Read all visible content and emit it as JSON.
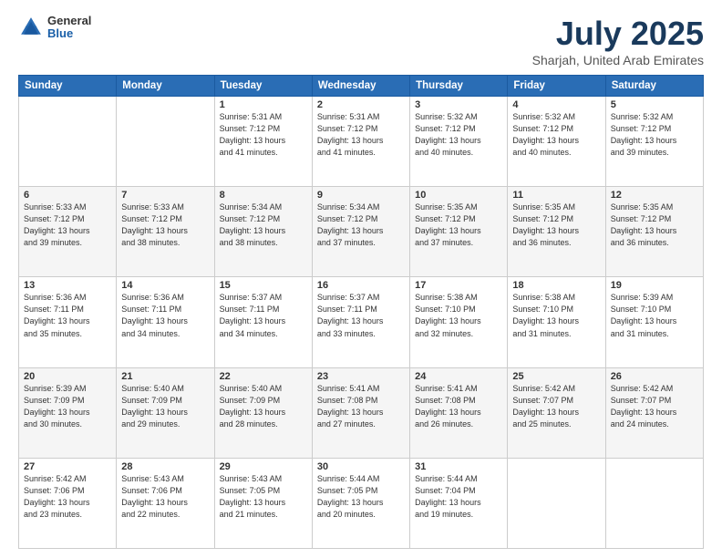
{
  "header": {
    "logo": {
      "general": "General",
      "blue": "Blue"
    },
    "month": "July 2025",
    "location": "Sharjah, United Arab Emirates"
  },
  "weekdays": [
    "Sunday",
    "Monday",
    "Tuesday",
    "Wednesday",
    "Thursday",
    "Friday",
    "Saturday"
  ],
  "weeks": [
    [
      {
        "day": "",
        "info": ""
      },
      {
        "day": "",
        "info": ""
      },
      {
        "day": "1",
        "info": "Sunrise: 5:31 AM\nSunset: 7:12 PM\nDaylight: 13 hours\nand 41 minutes."
      },
      {
        "day": "2",
        "info": "Sunrise: 5:31 AM\nSunset: 7:12 PM\nDaylight: 13 hours\nand 41 minutes."
      },
      {
        "day": "3",
        "info": "Sunrise: 5:32 AM\nSunset: 7:12 PM\nDaylight: 13 hours\nand 40 minutes."
      },
      {
        "day": "4",
        "info": "Sunrise: 5:32 AM\nSunset: 7:12 PM\nDaylight: 13 hours\nand 40 minutes."
      },
      {
        "day": "5",
        "info": "Sunrise: 5:32 AM\nSunset: 7:12 PM\nDaylight: 13 hours\nand 39 minutes."
      }
    ],
    [
      {
        "day": "6",
        "info": "Sunrise: 5:33 AM\nSunset: 7:12 PM\nDaylight: 13 hours\nand 39 minutes."
      },
      {
        "day": "7",
        "info": "Sunrise: 5:33 AM\nSunset: 7:12 PM\nDaylight: 13 hours\nand 38 minutes."
      },
      {
        "day": "8",
        "info": "Sunrise: 5:34 AM\nSunset: 7:12 PM\nDaylight: 13 hours\nand 38 minutes."
      },
      {
        "day": "9",
        "info": "Sunrise: 5:34 AM\nSunset: 7:12 PM\nDaylight: 13 hours\nand 37 minutes."
      },
      {
        "day": "10",
        "info": "Sunrise: 5:35 AM\nSunset: 7:12 PM\nDaylight: 13 hours\nand 37 minutes."
      },
      {
        "day": "11",
        "info": "Sunrise: 5:35 AM\nSunset: 7:12 PM\nDaylight: 13 hours\nand 36 minutes."
      },
      {
        "day": "12",
        "info": "Sunrise: 5:35 AM\nSunset: 7:12 PM\nDaylight: 13 hours\nand 36 minutes."
      }
    ],
    [
      {
        "day": "13",
        "info": "Sunrise: 5:36 AM\nSunset: 7:11 PM\nDaylight: 13 hours\nand 35 minutes."
      },
      {
        "day": "14",
        "info": "Sunrise: 5:36 AM\nSunset: 7:11 PM\nDaylight: 13 hours\nand 34 minutes."
      },
      {
        "day": "15",
        "info": "Sunrise: 5:37 AM\nSunset: 7:11 PM\nDaylight: 13 hours\nand 34 minutes."
      },
      {
        "day": "16",
        "info": "Sunrise: 5:37 AM\nSunset: 7:11 PM\nDaylight: 13 hours\nand 33 minutes."
      },
      {
        "day": "17",
        "info": "Sunrise: 5:38 AM\nSunset: 7:10 PM\nDaylight: 13 hours\nand 32 minutes."
      },
      {
        "day": "18",
        "info": "Sunrise: 5:38 AM\nSunset: 7:10 PM\nDaylight: 13 hours\nand 31 minutes."
      },
      {
        "day": "19",
        "info": "Sunrise: 5:39 AM\nSunset: 7:10 PM\nDaylight: 13 hours\nand 31 minutes."
      }
    ],
    [
      {
        "day": "20",
        "info": "Sunrise: 5:39 AM\nSunset: 7:09 PM\nDaylight: 13 hours\nand 30 minutes."
      },
      {
        "day": "21",
        "info": "Sunrise: 5:40 AM\nSunset: 7:09 PM\nDaylight: 13 hours\nand 29 minutes."
      },
      {
        "day": "22",
        "info": "Sunrise: 5:40 AM\nSunset: 7:09 PM\nDaylight: 13 hours\nand 28 minutes."
      },
      {
        "day": "23",
        "info": "Sunrise: 5:41 AM\nSunset: 7:08 PM\nDaylight: 13 hours\nand 27 minutes."
      },
      {
        "day": "24",
        "info": "Sunrise: 5:41 AM\nSunset: 7:08 PM\nDaylight: 13 hours\nand 26 minutes."
      },
      {
        "day": "25",
        "info": "Sunrise: 5:42 AM\nSunset: 7:07 PM\nDaylight: 13 hours\nand 25 minutes."
      },
      {
        "day": "26",
        "info": "Sunrise: 5:42 AM\nSunset: 7:07 PM\nDaylight: 13 hours\nand 24 minutes."
      }
    ],
    [
      {
        "day": "27",
        "info": "Sunrise: 5:42 AM\nSunset: 7:06 PM\nDaylight: 13 hours\nand 23 minutes."
      },
      {
        "day": "28",
        "info": "Sunrise: 5:43 AM\nSunset: 7:06 PM\nDaylight: 13 hours\nand 22 minutes."
      },
      {
        "day": "29",
        "info": "Sunrise: 5:43 AM\nSunset: 7:05 PM\nDaylight: 13 hours\nand 21 minutes."
      },
      {
        "day": "30",
        "info": "Sunrise: 5:44 AM\nSunset: 7:05 PM\nDaylight: 13 hours\nand 20 minutes."
      },
      {
        "day": "31",
        "info": "Sunrise: 5:44 AM\nSunset: 7:04 PM\nDaylight: 13 hours\nand 19 minutes."
      },
      {
        "day": "",
        "info": ""
      },
      {
        "day": "",
        "info": ""
      }
    ]
  ]
}
